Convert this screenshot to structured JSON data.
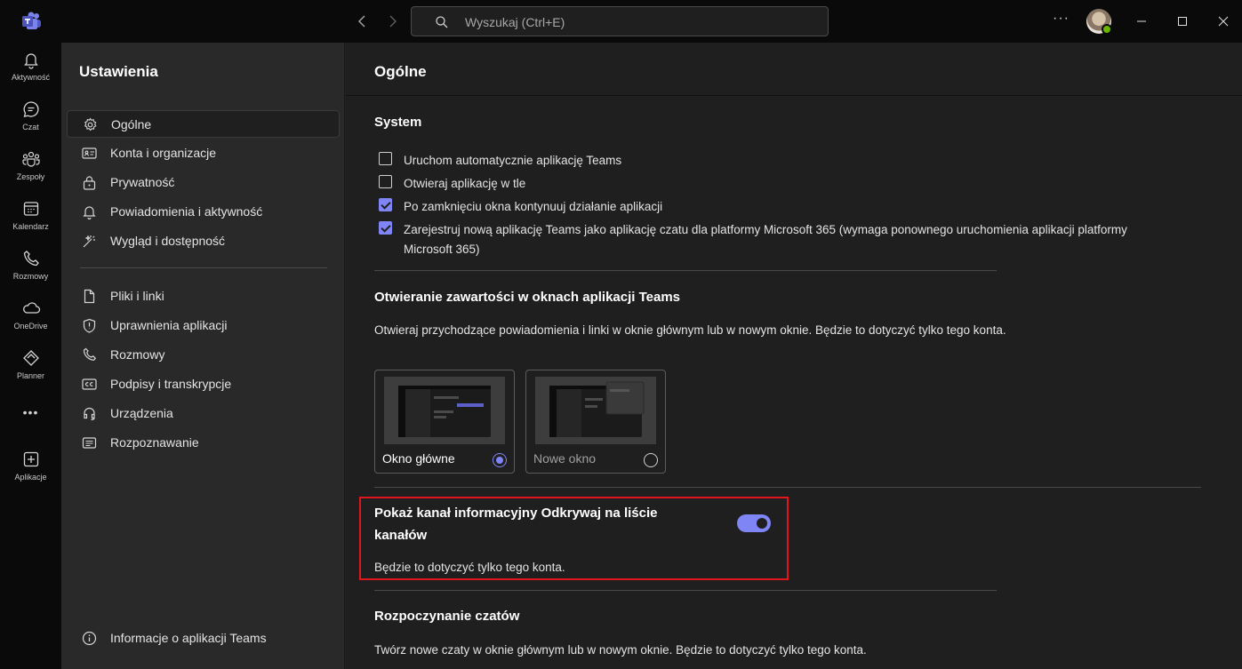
{
  "titlebar": {
    "search_placeholder": "Wyszukaj (Ctrl+E)",
    "more_label": "···"
  },
  "rail": {
    "items": [
      {
        "label": "Aktywność",
        "icon": "bell-icon"
      },
      {
        "label": "Czat",
        "icon": "chat-icon"
      },
      {
        "label": "Zespoły",
        "icon": "teams-icon"
      },
      {
        "label": "Kalendarz",
        "icon": "calendar-icon"
      },
      {
        "label": "Rozmowy",
        "icon": "phone-icon"
      },
      {
        "label": "OneDrive",
        "icon": "cloud-icon"
      },
      {
        "label": "Planner",
        "icon": "planner-icon"
      },
      {
        "label": "Aplikacje",
        "icon": "add-app-icon"
      }
    ],
    "more_label": "•••"
  },
  "sidebar": {
    "title": "Ustawienia",
    "items": [
      {
        "label": "Ogólne",
        "icon": "gear-icon",
        "active": true
      },
      {
        "label": "Konta i organizacje",
        "icon": "id-card-icon"
      },
      {
        "label": "Prywatność",
        "icon": "lock-icon"
      },
      {
        "label": "Powiadomienia i aktywność",
        "icon": "bell-icon"
      },
      {
        "label": "Wygląd i dostępność",
        "icon": "magic-wand-icon"
      },
      {
        "label": "Pliki i linki",
        "icon": "file-icon"
      },
      {
        "label": "Uprawnienia aplikacji",
        "icon": "shield-icon"
      },
      {
        "label": "Rozmowy",
        "icon": "phone-icon"
      },
      {
        "label": "Podpisy i transkrypcje",
        "icon": "cc-icon"
      },
      {
        "label": "Urządzenia",
        "icon": "headset-icon"
      },
      {
        "label": "Rozpoznawanie",
        "icon": "document-icon"
      }
    ],
    "about": {
      "label": "Informacje o aplikacji Teams",
      "icon": "info-icon"
    }
  },
  "main": {
    "title": "Ogólne",
    "system": {
      "title": "System",
      "options": [
        {
          "label": "Uruchom automatycznie aplikację Teams",
          "checked": false
        },
        {
          "label": "Otwieraj aplikację w tle",
          "checked": false
        },
        {
          "label": "Po zamknięciu okna kontynuuj działanie aplikacji",
          "checked": true
        },
        {
          "label": "Zarejestruj nową aplikację Teams jako aplikację czatu dla platformy Microsoft 365 (wymaga ponownego uruchomienia aplikacji platformy Microsoft 365)",
          "checked": true
        }
      ]
    },
    "open_content": {
      "title": "Otwieranie zawartości w oknach aplikacji Teams",
      "description": "Otwieraj przychodzące powiadomienia i linki w oknie głównym lub w nowym oknie. Będzie to dotyczyć tylko tego konta.",
      "choices": [
        {
          "label": "Okno główne",
          "selected": true
        },
        {
          "label": "Nowe okno",
          "selected": false
        }
      ]
    },
    "discover_feed": {
      "title": "Pokaż kanał informacyjny Odkrywaj na liście kanałów",
      "note": "Będzie to dotyczyć tylko tego konta.",
      "enabled": true
    },
    "start_chats": {
      "title": "Rozpoczynanie czatów",
      "description": "Twórz nowe czaty w oknie głównym lub w nowym oknie. Będzie to dotyczyć tylko tego konta."
    }
  },
  "colors": {
    "accent": "#7f85f5",
    "highlight_border": "#e0161c",
    "presence": "#6bb700"
  }
}
